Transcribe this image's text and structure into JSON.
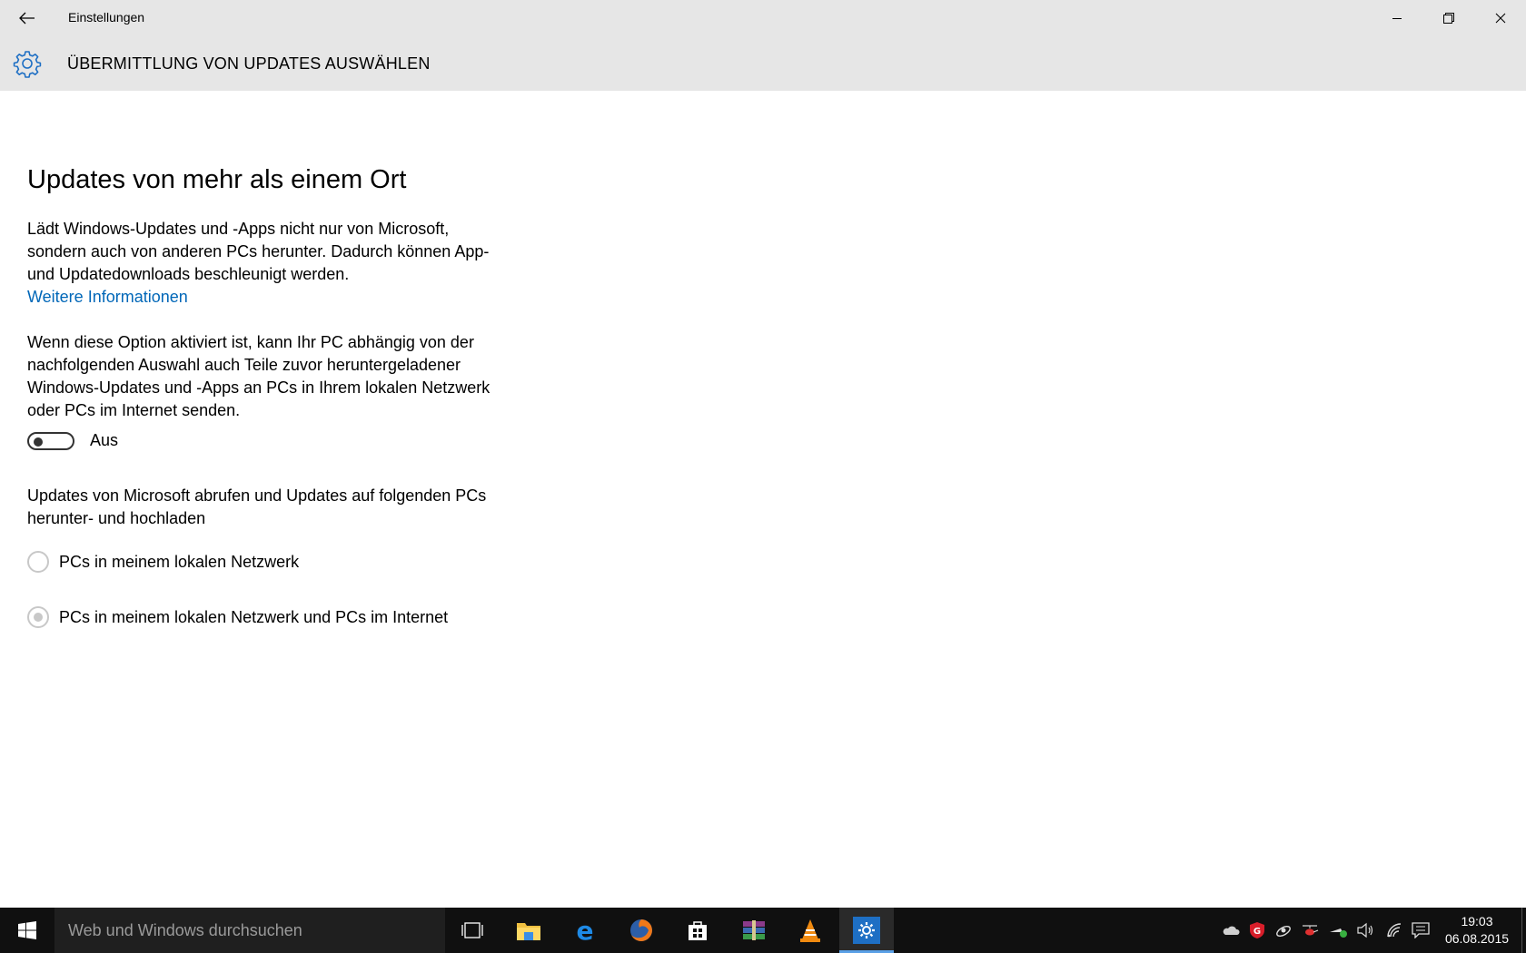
{
  "window": {
    "title": "Einstellungen",
    "back_icon": "arrow-left-icon",
    "controls": [
      "minimize-icon",
      "restore-icon",
      "close-icon"
    ]
  },
  "header": {
    "title": "ÜBERMITTLUNG VON UPDATES AUSWÄHLEN",
    "icon": "gear-icon",
    "accent": "#1e6fc4"
  },
  "content": {
    "heading": "Updates von mehr als einem Ort",
    "description_lines": [
      "Lädt Windows-Updates und -Apps nicht nur von Microsoft,",
      "sondern auch von anderen PCs herunter. Dadurch können App-",
      "und Updatedownloads beschleunigt werden."
    ],
    "more_info_link": "Weitere Informationen",
    "option_lines": [
      "Wenn diese Option aktiviert ist, kann Ihr PC abhängig von der",
      "nachfolgenden Auswahl auch Teile zuvor heruntergeladener",
      "Windows-Updates und -Apps an PCs in Ihrem lokalen Netzwerk",
      "oder PCs im Internet senden."
    ],
    "toggle": {
      "state": "off",
      "label": "Aus"
    },
    "radio_group_lines": [
      "Updates von Microsoft abrufen und Updates auf folgenden PCs",
      "herunter- und hochladen"
    ],
    "radio_options": [
      {
        "label": "PCs in meinem lokalen Netzwerk",
        "checked": false
      },
      {
        "label": "PCs in meinem lokalen Netzwerk und PCs im Internet",
        "checked": true
      }
    ],
    "link_color": "#0067b8"
  },
  "taskbar": {
    "search_placeholder": "Web und Windows durchsuchen",
    "apps": [
      "task-view-icon",
      "file-explorer-icon",
      "edge-icon",
      "firefox-icon",
      "store-icon",
      "winrar-icon",
      "vlc-icon",
      "settings-icon"
    ],
    "active_app": "settings-icon",
    "tray_icons": [
      "onedrive-icon",
      "gdata-shield-icon",
      "satellite-icon",
      "helicopter-icon",
      "network-status-icon",
      "volume-icon",
      "wifi-icon",
      "action-center-icon"
    ],
    "time": "19:03",
    "date": "06.08.2015"
  }
}
